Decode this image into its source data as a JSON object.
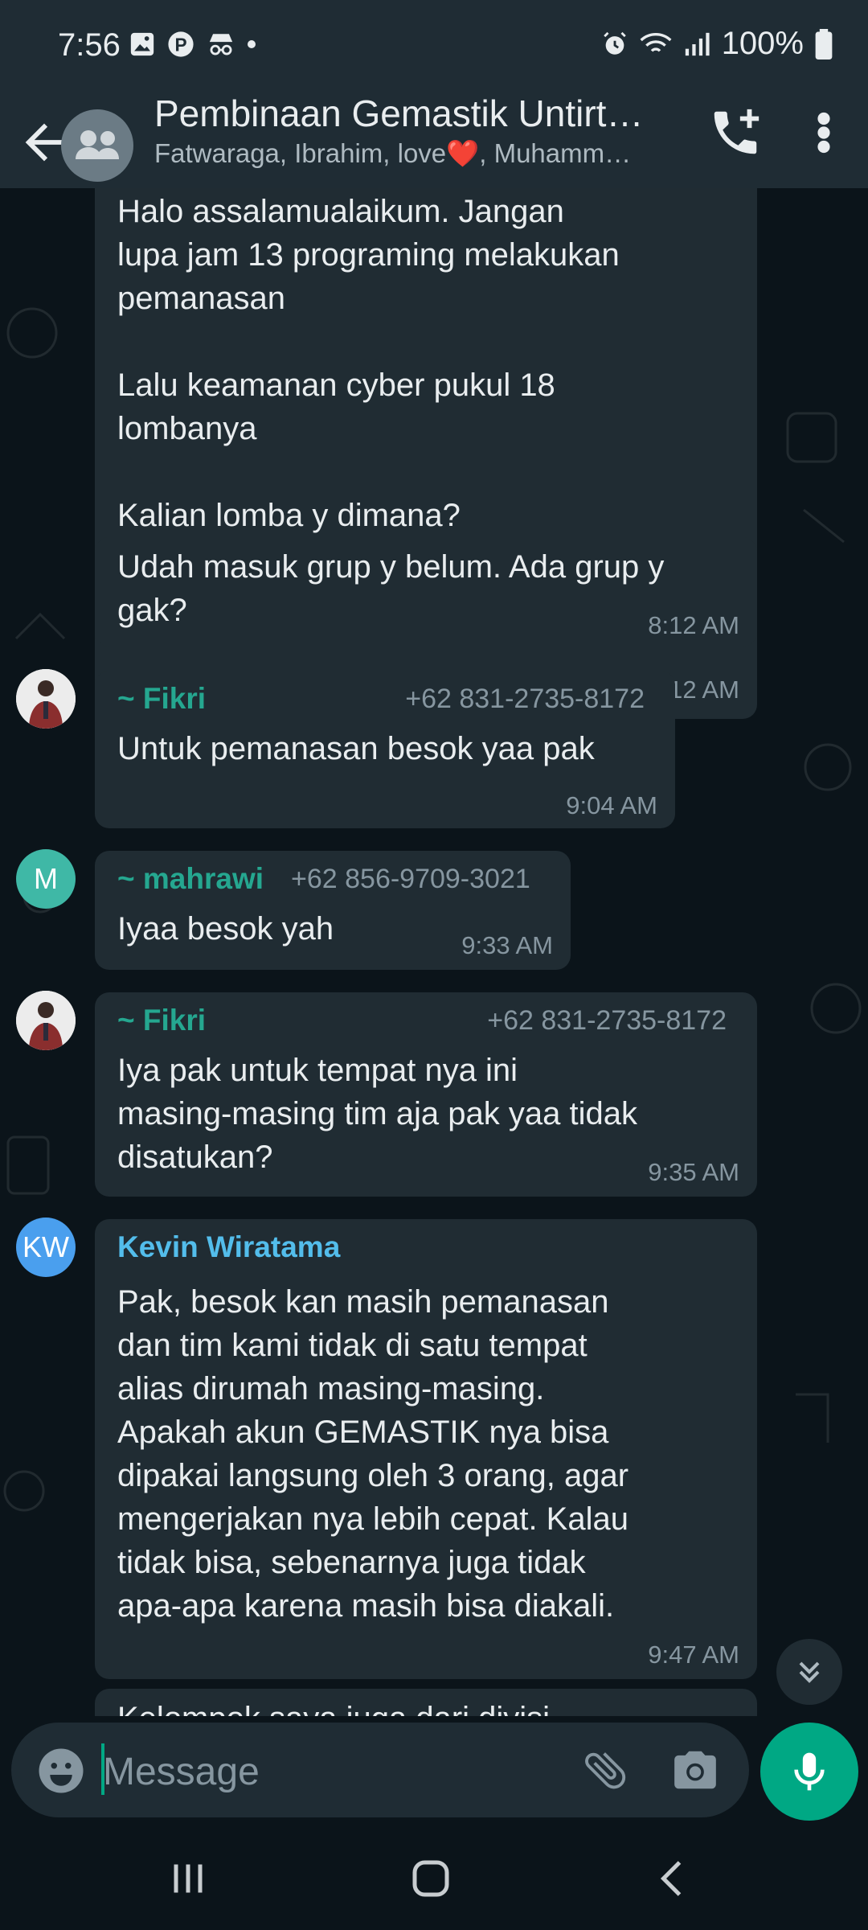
{
  "status_bar": {
    "time": "7:56",
    "battery": "100%"
  },
  "header": {
    "title": "Pembinaan Gemastik Untirt…",
    "subtitle": "Fatwaraga, Ibrahim, love❤️, Muhamm…"
  },
  "messages": [
    {
      "text": "Halo assalamualaikum. Jangan\nlupa jam 13 programing melakukan\npemanasan\n\nLalu keamanan cyber pukul 18\nlombanya\n\nKalian lomba y dimana?",
      "time": "8:12 AM"
    },
    {
      "text": "Udah masuk grup y belum. Ada grup y\ngak?",
      "time": "8:12 AM"
    },
    {
      "sender": "~ Fikri",
      "phone": "+62 831-2735-8172",
      "text": "Untuk pemanasan besok yaa pak",
      "time": "9:04 AM",
      "sender_color": "#25a790"
    },
    {
      "sender": "~ mahrawi",
      "phone": "+62 856-9709-3021",
      "text": "Iyaa besok yah",
      "time": "9:33 AM",
      "sender_color": "#25a790",
      "avatar_letter": "M",
      "avatar_color": "#3fb8a6"
    },
    {
      "sender": "~ Fikri",
      "phone": "+62 831-2735-8172",
      "text": "Iya pak untuk tempat nya ini\nmasing-masing tim aja pak yaa tidak\ndisatukan?",
      "time": "9:35 AM",
      "sender_color": "#25a790"
    },
    {
      "sender": "Kevin Wiratama",
      "text": "Pak, besok kan masih pemanasan\ndan tim kami tidak di satu tempat\nalias dirumah masing-masing.\nApakah akun GEMASTIK nya bisa\ndipakai langsung oleh 3 orang, agar\nmengerjakan nya lebih cepat. Kalau\ntidak bisa, sebenarnya juga tidak\napa-apa karena masih bisa diakali.",
      "time": "9:47 AM",
      "sender_color": "#53bdeb",
      "avatar_letter": "KW",
      "avatar_color": "#4a9fee"
    },
    {
      "text": "Kelompok saya juga dari divisi"
    }
  ],
  "input": {
    "placeholder": "Message"
  },
  "colors": {
    "accent": "#00a884",
    "bubble": "#202c33",
    "background": "#0b141a",
    "header": "#1f2c34"
  }
}
